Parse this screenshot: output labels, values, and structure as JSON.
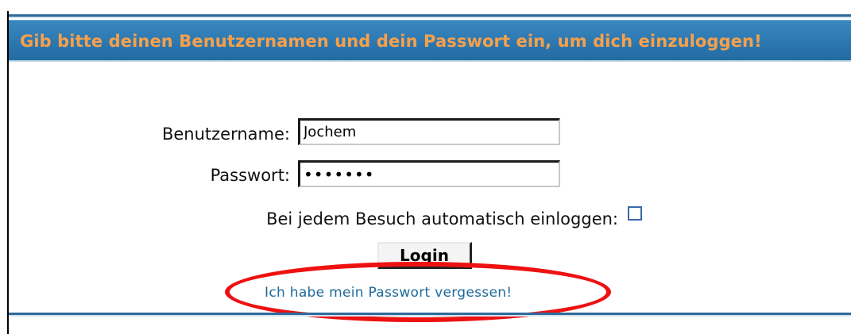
{
  "header": {
    "title": "Gib bitte deinen Benutzernamen und dein Passwort ein, um dich einzuloggen!"
  },
  "form": {
    "username_label": "Benutzername:",
    "username_value": "Jochem",
    "password_label": "Passwort:",
    "password_value": "•••••••",
    "autologin_label": "Bei jedem Besuch automatisch einloggen:",
    "autologin_checked": false,
    "login_button_label": "Login",
    "forgot_password_link": "Ich habe mein Passwort vergessen!"
  },
  "colors": {
    "header_bg": "#2f7ab3",
    "header_text": "#f7a04a",
    "link": "#1e6a9a",
    "highlight_ellipse": "#ee1111"
  }
}
